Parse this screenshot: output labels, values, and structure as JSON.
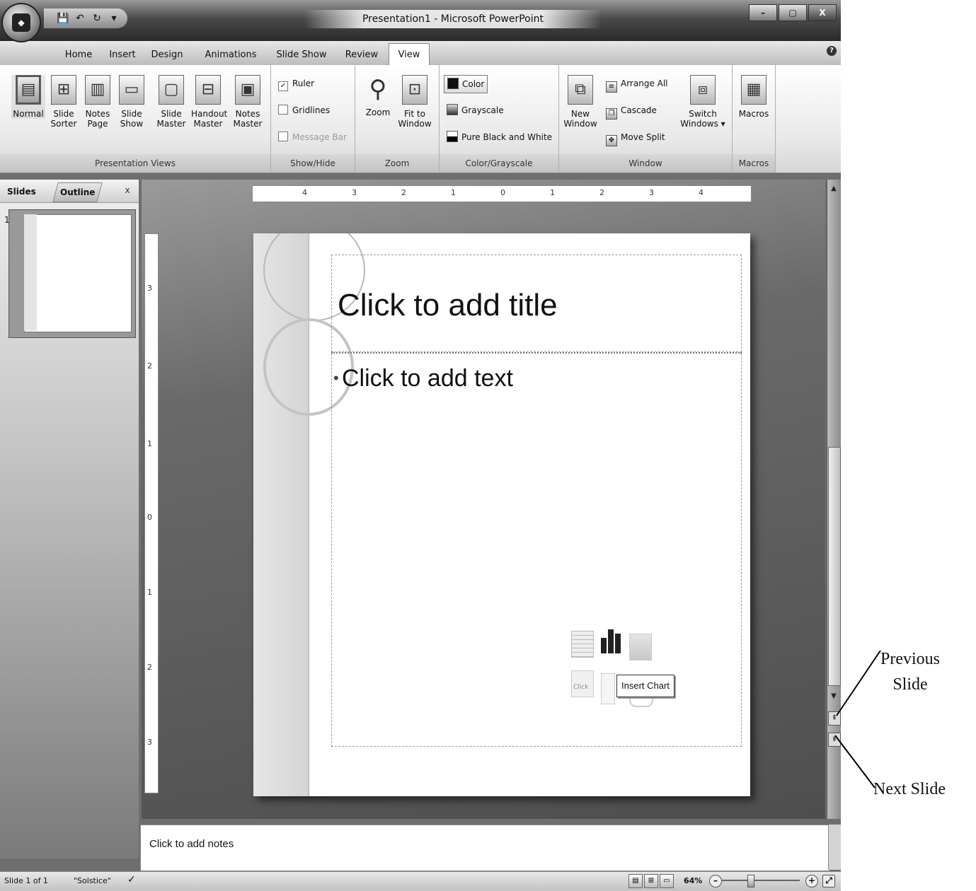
{
  "window": {
    "title": "Presentation1 - Microsoft PowerPoint",
    "minimize": "–",
    "maximize": "▢",
    "close": "X",
    "office_logo": "Office"
  },
  "quick_access": {
    "save": "💾",
    "undo": "↶",
    "redo": "↻",
    "customize": "▾"
  },
  "tabs": [
    "Home",
    "Insert",
    "Design",
    "Animations",
    "Slide Show",
    "Review",
    "View"
  ],
  "active_tab": "View",
  "help": "?",
  "ribbon": {
    "presentation_views": {
      "label": "Presentation Views",
      "buttons": [
        {
          "l1": "Normal",
          "l2": ""
        },
        {
          "l1": "Slide",
          "l2": "Sorter"
        },
        {
          "l1": "Notes",
          "l2": "Page"
        },
        {
          "l1": "Slide",
          "l2": "Show"
        },
        {
          "l1": "Slide",
          "l2": "Master"
        },
        {
          "l1": "Handout",
          "l2": "Master"
        },
        {
          "l1": "Notes",
          "l2": "Master"
        }
      ]
    },
    "show_hide": {
      "label": "Show/Hide",
      "ruler": "Ruler",
      "gridlines": "Gridlines",
      "message_bar": "Message Bar",
      "checked_mark": "✓"
    },
    "zoom": {
      "label": "Zoom",
      "zoom": "Zoom",
      "fit_l1": "Fit to",
      "fit_l2": "Window"
    },
    "color_grayscale": {
      "label": "Color/Grayscale",
      "color": "Color",
      "grayscale": "Grayscale",
      "pure_bw": "Pure Black and White"
    },
    "window": {
      "label": "Window",
      "new_l1": "New",
      "new_l2": "Window",
      "arrange_all": "Arrange All",
      "cascade": "Cascade",
      "move_split": "Move Split",
      "switch_l1": "Switch",
      "switch_l2": "Windows ▾"
    },
    "macros": {
      "label": "Macros",
      "macros": "Macros"
    }
  },
  "left_panel": {
    "tab_slides": "Slides",
    "tab_outline": "Outline",
    "close": "x",
    "slide_number": "1"
  },
  "ruler": {
    "h_labels": [
      "4",
      "3",
      "2",
      "1",
      "0",
      "1",
      "2",
      "3",
      "4"
    ],
    "v_labels": [
      "3",
      "2",
      "1",
      "0",
      "1",
      "2",
      "3"
    ]
  },
  "slide": {
    "title_placeholder": "Click to add title",
    "bullet": "•",
    "body_placeholder": "Click to add text",
    "tooltip": "Insert Chart",
    "picture_label": "Click"
  },
  "notes": {
    "placeholder": "Click to add notes"
  },
  "status": {
    "slide_count": "Slide 1 of 1",
    "theme": "\"Solstice\"",
    "spell_icon": "✓",
    "zoom": "64%",
    "zoom_out": "–",
    "zoom_in": "+",
    "fit": "⤢"
  },
  "scrollbar": {
    "up": "▲",
    "down": "▼",
    "prev": "⇞",
    "next": "⇟"
  },
  "annotations": {
    "previous_l1": "Previous",
    "previous_l2": "Slide",
    "next": "Next Slide"
  }
}
